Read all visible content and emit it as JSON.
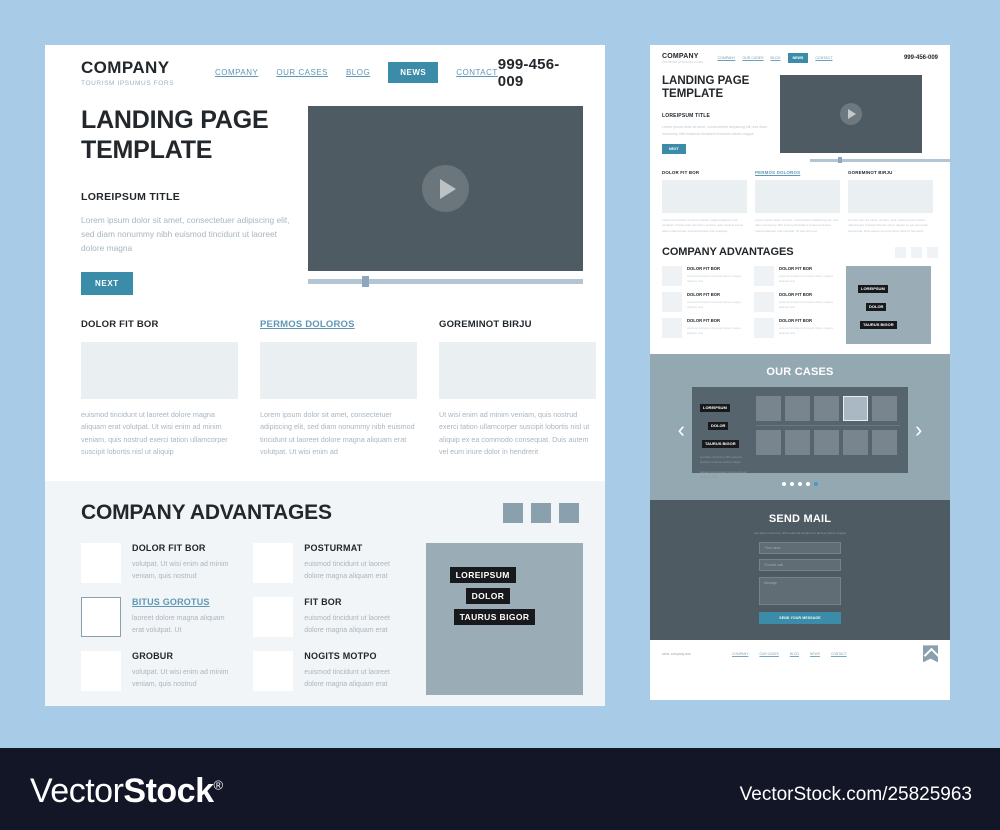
{
  "background_color": "#a8cbe8",
  "accent_color": "#3b8ca8",
  "desktop": {
    "header": {
      "logo_main": "COMPANY",
      "logo_sub": "TOURISM IPSUMUS FORS",
      "nav": [
        {
          "label": "COMPANY",
          "active": false
        },
        {
          "label": "OUR CASES",
          "active": false
        },
        {
          "label": "BLOG",
          "active": false
        },
        {
          "label": "NEWS",
          "active": true
        },
        {
          "label": "CONTACT",
          "active": false
        }
      ],
      "phone": "999-456-009"
    },
    "hero": {
      "title_line1": "LANDING PAGE",
      "title_line2": "TEMPLATE",
      "subtitle": "LOREIPSUM TITLE",
      "text": "Lorem ipsum dolor sit amet, consectetuer adipiscing elit, sed diam nonummy nibh euismod tincidunt ut laoreet dolore magna",
      "button": "NEXT"
    },
    "columns": [
      {
        "title": "DOLOR FIT BOR",
        "is_link": false,
        "text": "euismod tincidunt ut laoreet dolore magna aliquam erat volutpat. Ut wisi enim ad minim veniam, quis nostrud exerci tation ullamcorper suscipit lobortis nisl ut aliquip"
      },
      {
        "title": "PERMOS DOLOROS",
        "is_link": true,
        "text": "Lorem ipsum dolor sit amet, consectetuer adipiscing elit, sed diam nonummy nibh euismod tincidunt ut laoreet dolore magna aliquam erat volutpat. Ut wisi enim ad"
      },
      {
        "title": "GOREMINOT BIRJU",
        "is_link": false,
        "text": "Ut wisi enim ad minim veniam, quis nostrud exerci tation ullamcorper suscipit lobortis nisl ut aliquip ex ea commodo consequat. Duis autem vel eum iriure dolor in hendrerit"
      }
    ],
    "advantages": {
      "title": "COMPANY ADVANTAGES",
      "column_left": [
        {
          "title": "DOLOR FIT BOR",
          "is_link": false,
          "outlined": false,
          "text": " volutpat. Ut wisi enim ad minim veniam, quis nostrud"
        },
        {
          "title": "BITUS GOROTUS",
          "is_link": true,
          "outlined": true,
          "text": "laoreet dolore magna aliquam erat volutpat. Ut"
        },
        {
          "title": "GROBUR",
          "is_link": false,
          "outlined": false,
          "text": "volutpat. Ut wisi enim ad minim veniam, quis nostrud"
        }
      ],
      "column_right": [
        {
          "title": "POSTURMAT",
          "is_link": false,
          "outlined": false,
          "text": "euismod tincidunt ut laoreet dolore magna aliquam erat"
        },
        {
          "title": "FIT BOR",
          "is_link": false,
          "outlined": false,
          "text": "euismod tincidunt ut laoreet dolore magna aliquam erat"
        },
        {
          "title": "NOGITS MOTPO",
          "is_link": false,
          "outlined": false,
          "text": "euismod tincidunt ut laoreet dolore magna aliquam erat"
        }
      ],
      "panel_tags": [
        "LOREIPSUM",
        "DOLOR",
        "TAURUS BIGOR"
      ]
    }
  },
  "mini": {
    "header": {
      "logo_main": "COMPANY",
      "logo_sub": "TOURISM IPSUMUS FORS",
      "nav": [
        {
          "label": "COMPANY",
          "active": false
        },
        {
          "label": "OUR CASES",
          "active": false
        },
        {
          "label": "BLOG",
          "active": false
        },
        {
          "label": "NEWS",
          "active": true
        },
        {
          "label": "CONTACT",
          "active": false
        }
      ],
      "phone": "999-456-009"
    },
    "hero": {
      "title_line1": "LANDING PAGE",
      "title_line2": "TEMPLATE",
      "subtitle": "LOREIPSUM TITLE",
      "text": "Lorem ipsum dolor sit amet, consectetuer adipiscing elit, sed diam nonummy nibh euismod tincidunt ut laoreet dolore magna",
      "button": "NEXT"
    },
    "columns": [
      {
        "title": "DOLOR FIT BOR",
        "is_link": false,
        "text": "euismod tincidunt ut laoreet dolore magna aliquam erat volutpat. Ut wisi enim ad minim veniam, quis nostrud exerci tation ullamcorper suscipit lobortis nisl ut aliquip"
      },
      {
        "title": "PERMOS DOLOROS",
        "is_link": true,
        "text": "Lorem ipsum dolor sit amet, consectetuer adipiscing elit, sed diam nonummy nibh euismod tincidunt ut laoreet dolore magna aliquam erat volutpat. Ut wisi enim ad"
      },
      {
        "title": "GOREMINOT BIRJU",
        "is_link": false,
        "text": "Ut wisi enim ad minim veniam, quis nostrud exerci tation ullamcorper suscipit lobortis nisl ut aliquip ex ea commodo consequat. Duis autem vel eum iriure dolor in hendrerit"
      }
    ],
    "advantages": {
      "title": "COMPANY ADVANTAGES",
      "column_left": [
        {
          "title": "DOLOR FIT BOR",
          "text": "euismod tincidunt ut laoreet dolore magna aliquam erat"
        },
        {
          "title": "DOLOR FIT BOR",
          "text": "euismod tincidunt ut laoreet dolore magna aliquam erat"
        },
        {
          "title": "DOLOR FIT BOR",
          "text": "euismod tincidunt ut laoreet dolore magna aliquam erat"
        }
      ],
      "column_right": [
        {
          "title": "DOLOR FIT BOR",
          "text": "euismod tincidunt ut laoreet dolore magna aliquam erat"
        },
        {
          "title": "DOLOR FIT BOR",
          "text": "euismod tincidunt ut laoreet dolore magna aliquam erat"
        },
        {
          "title": "DOLOR FIT BOR",
          "text": "euismod tincidunt ut laoreet dolore magna aliquam erat"
        }
      ],
      "panel_tags": [
        "LOREIPSUM",
        "DOLOR",
        "TAURUS BIGOR"
      ]
    },
    "cases": {
      "title": "OUR CASES",
      "tags": [
        "LOREIPSUM",
        "DOLOR",
        "TAURUS BIGOR"
      ],
      "text1": "sed diam nonummy nibh euismod tincidunt ut laoreet dolore magna",
      "text2": "aliquam erat volutpat. Ut wisi enim ad minim veniam,",
      "prev_arrow": "‹",
      "next_arrow": "›",
      "dot_count": 5,
      "active_dot": 5,
      "thumbs_per_row": 5,
      "active_thumb": 4
    },
    "mail": {
      "title": "SEND MAIL",
      "text": "sed diam nonummy nibh euismod tincidunt ut laoreet dolore magna",
      "name_placeholder": "*Your name",
      "email_placeholder": "*Contact mail",
      "message_placeholder": "Message",
      "submit": "SEND YOUR MESSAGE"
    },
    "footer": {
      "url": "www. company.com",
      "links": [
        "COMPANY",
        "OUR CASES",
        "BLOG",
        "NEWS",
        "CONTACT"
      ]
    }
  },
  "watermark": {
    "brand_light": "Vector",
    "brand_bold": "Stock",
    "registered": "®",
    "url": "VectorStock.com/25825963"
  }
}
